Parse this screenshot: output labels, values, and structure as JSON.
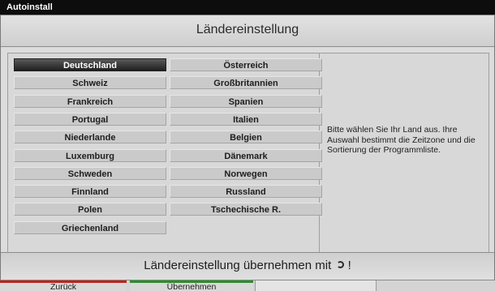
{
  "window": {
    "title": "Autoinstall"
  },
  "header": {
    "title": "Ländereinstellung"
  },
  "countries_left": [
    {
      "label": "Deutschland",
      "selected": true
    },
    {
      "label": "Schweiz"
    },
    {
      "label": "Frankreich"
    },
    {
      "label": "Portugal"
    },
    {
      "label": "Niederlande"
    },
    {
      "label": "Luxemburg"
    },
    {
      "label": "Schweden"
    },
    {
      "label": "Finnland"
    },
    {
      "label": "Polen"
    },
    {
      "label": "Griechenland"
    }
  ],
  "countries_right": [
    {
      "label": "Österreich"
    },
    {
      "label": "Großbritannien"
    },
    {
      "label": "Spanien"
    },
    {
      "label": "Italien"
    },
    {
      "label": "Belgien"
    },
    {
      "label": "Dänemark"
    },
    {
      "label": "Norwegen"
    },
    {
      "label": "Russland"
    },
    {
      "label": "Tschechische R."
    }
  ],
  "info": {
    "text": "Bitte wählen Sie Ihr Land aus. Ihre Auswahl bestimmt die Zeitzone und die Sortierung der Programmliste."
  },
  "confirm": {
    "text": "Ländereinstellung übernehmen mit",
    "suffix": "!",
    "icon": "ok-icon"
  },
  "footer": {
    "back_label": "Zurück",
    "apply_label": "Übernehmen"
  },
  "colors": {
    "red": "#c0221c",
    "green": "#2a8e2a",
    "selected": "#1f1f1f"
  }
}
